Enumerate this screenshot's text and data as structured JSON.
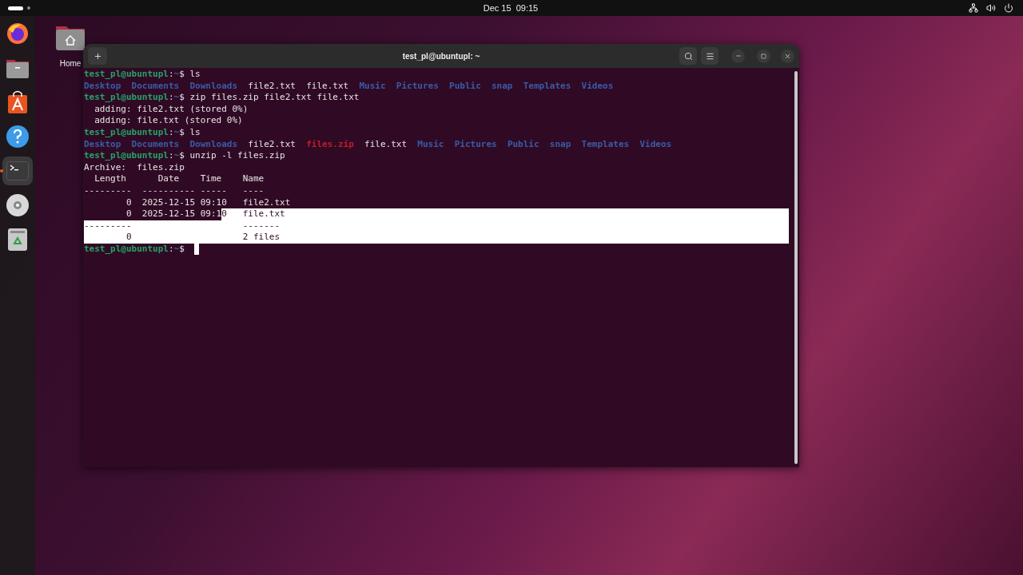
{
  "top_bar": {
    "clock": "Dec 15  09:15"
  },
  "dock": {
    "items": [
      {
        "selected": false
      },
      {
        "selected": false
      },
      {
        "selected": false
      },
      {
        "selected": false
      },
      {
        "selected": true
      },
      {
        "selected": false
      },
      {
        "selected": false
      }
    ]
  },
  "desktop_icons": [
    {
      "label": "Home"
    }
  ],
  "terminal": {
    "title": "test_pl@ubuntupl: ~",
    "lines": [
      {
        "segments": [
          {
            "text": "test_pl@ubuntupl",
            "kind": "user",
            "selected": false
          },
          {
            "text": ":",
            "kind": "plain",
            "selected": false
          },
          {
            "text": "~",
            "kind": "path",
            "selected": false
          },
          {
            "text": "$ ls",
            "kind": "plain",
            "selected": false
          }
        ]
      },
      {
        "segments": [
          {
            "text": "Desktop  ",
            "kind": "dir",
            "selected": false
          },
          {
            "text": "Documents  ",
            "kind": "dir",
            "selected": false
          },
          {
            "text": "Downloads  ",
            "kind": "dir",
            "selected": false
          },
          {
            "text": "file2.txt  ",
            "kind": "plain",
            "selected": false
          },
          {
            "text": "file.txt  ",
            "kind": "plain",
            "selected": false
          },
          {
            "text": "Music  ",
            "kind": "dir",
            "selected": false
          },
          {
            "text": "Pictures  ",
            "kind": "dir",
            "selected": false
          },
          {
            "text": "Public  ",
            "kind": "dir",
            "selected": false
          },
          {
            "text": "snap  ",
            "kind": "dir",
            "selected": false
          },
          {
            "text": "Templates  ",
            "kind": "dir",
            "selected": false
          },
          {
            "text": "Videos",
            "kind": "dir",
            "selected": false
          }
        ]
      },
      {
        "segments": [
          {
            "text": "test_pl@ubuntupl",
            "kind": "user",
            "selected": false
          },
          {
            "text": ":",
            "kind": "plain",
            "selected": false
          },
          {
            "text": "~",
            "kind": "path",
            "selected": false
          },
          {
            "text": "$ zip files.zip file2.txt file.txt",
            "kind": "plain",
            "selected": false
          }
        ]
      },
      {
        "segments": [
          {
            "text": "  adding: file2.txt (stored 0%)",
            "kind": "plain",
            "selected": false
          }
        ]
      },
      {
        "segments": [
          {
            "text": "  adding: file.txt (stored 0%)",
            "kind": "plain",
            "selected": false
          }
        ]
      },
      {
        "segments": [
          {
            "text": "test_pl@ubuntupl",
            "kind": "user",
            "selected": false
          },
          {
            "text": ":",
            "kind": "plain",
            "selected": false
          },
          {
            "text": "~",
            "kind": "path",
            "selected": false
          },
          {
            "text": "$ ls",
            "kind": "plain",
            "selected": false
          }
        ]
      },
      {
        "segments": [
          {
            "text": "Desktop  ",
            "kind": "dir",
            "selected": false
          },
          {
            "text": "Documents  ",
            "kind": "dir",
            "selected": false
          },
          {
            "text": "Downloads  ",
            "kind": "dir",
            "selected": false
          },
          {
            "text": "file2.txt  ",
            "kind": "plain",
            "selected": false
          },
          {
            "text": "files.zip  ",
            "kind": "archive",
            "selected": false
          },
          {
            "text": "file.txt  ",
            "kind": "plain",
            "selected": false
          },
          {
            "text": "Music  ",
            "kind": "dir",
            "selected": false
          },
          {
            "text": "Pictures  ",
            "kind": "dir",
            "selected": false
          },
          {
            "text": "Public  ",
            "kind": "dir",
            "selected": false
          },
          {
            "text": "snap  ",
            "kind": "dir",
            "selected": false
          },
          {
            "text": "Templates  ",
            "kind": "dir",
            "selected": false
          },
          {
            "text": "Videos",
            "kind": "dir",
            "selected": false
          }
        ]
      },
      {
        "segments": [
          {
            "text": "test_pl@ubuntupl",
            "kind": "user",
            "selected": false
          },
          {
            "text": ":",
            "kind": "plain",
            "selected": false
          },
          {
            "text": "~",
            "kind": "path",
            "selected": false
          },
          {
            "text": "$ unzip -l files.zip",
            "kind": "plain",
            "selected": false
          }
        ]
      },
      {
        "segments": [
          {
            "text": "Archive:  files.zip",
            "kind": "plain",
            "selected": false
          }
        ]
      },
      {
        "segments": [
          {
            "text": "  Length      Date    Time    Name",
            "kind": "plain",
            "selected": false
          }
        ]
      },
      {
        "segments": [
          {
            "text": "---------  ---------- -----   ----",
            "kind": "plain",
            "selected": false
          }
        ]
      },
      {
        "segments": [
          {
            "text": "        0  2025-12-15 09:10   file2.txt",
            "kind": "plain",
            "selected": false
          }
        ]
      },
      {
        "segments": [
          {
            "text": "        0  2025-12-15 09:1",
            "kind": "plain",
            "selected": false
          },
          {
            "text": "0   file.txt",
            "kind": "plain",
            "selected": true
          }
        ]
      },
      {
        "segments": [
          {
            "text": "---------                     -------",
            "kind": "plain",
            "selected": true
          }
        ]
      },
      {
        "segments": [
          {
            "text": "        0                     2 files",
            "kind": "plain",
            "selected": true
          }
        ]
      },
      {
        "segments": [
          {
            "text": "test_pl@ubuntupl",
            "kind": "user",
            "selected": false
          },
          {
            "text": ":",
            "kind": "plain",
            "selected": false
          },
          {
            "text": "~",
            "kind": "path",
            "selected": false
          },
          {
            "text": "$ ",
            "kind": "plain",
            "selected": false
          }
        ],
        "cursor": true
      }
    ]
  }
}
